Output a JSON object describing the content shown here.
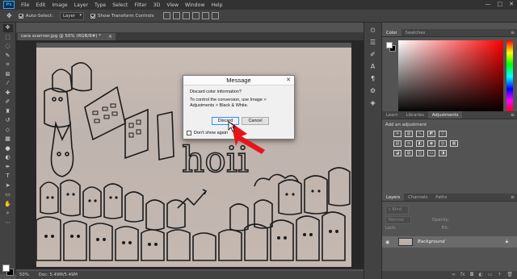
{
  "app": {
    "logo": "Ps"
  },
  "menu": [
    "File",
    "Edit",
    "Image",
    "Layer",
    "Type",
    "Select",
    "Filter",
    "3D",
    "View",
    "Window",
    "Help"
  ],
  "window_controls": {
    "minimize": "—",
    "maximize": "□",
    "close": "✕"
  },
  "options": {
    "auto_select_label": "Auto-Select:",
    "auto_select_value": "Layer",
    "show_transform_label": "Show Transform Controls"
  },
  "document": {
    "tab_label": "cara scanner.jpg @ 50% (RGB/8#) *",
    "tab_close": "×",
    "zoom": "50%",
    "doc_size": "Doc: 5.49M/5.49M",
    "sketch_text": "hoii"
  },
  "dialog": {
    "title": "Message",
    "close": "✕",
    "question": "Discard color information?",
    "detail": "To control the conversion, use Image > Adjustments > Black & White.",
    "discard_label": "Discard",
    "cancel_label": "Cancel",
    "dont_show_label": "Don't show again"
  },
  "color_panel": {
    "tabs": [
      "Color",
      "Swatches"
    ],
    "menu": "≡",
    "accent": "#ff0000"
  },
  "adjustments_panel": {
    "tabs": [
      "Learn",
      "Libraries",
      "Adjustments"
    ],
    "menu": "≡",
    "title": "Add an adjustment"
  },
  "layers_panel": {
    "tabs": [
      "Layers",
      "Channels",
      "Paths"
    ],
    "menu": "≡",
    "kind_label": "Kind",
    "blend_mode": "Normal",
    "opacity_label": "Opacity:",
    "lock_label": "Lock:",
    "fill_label": "Fill:",
    "layer_name": "Background"
  },
  "annotation": {
    "arrow_color": "#e8141a"
  }
}
